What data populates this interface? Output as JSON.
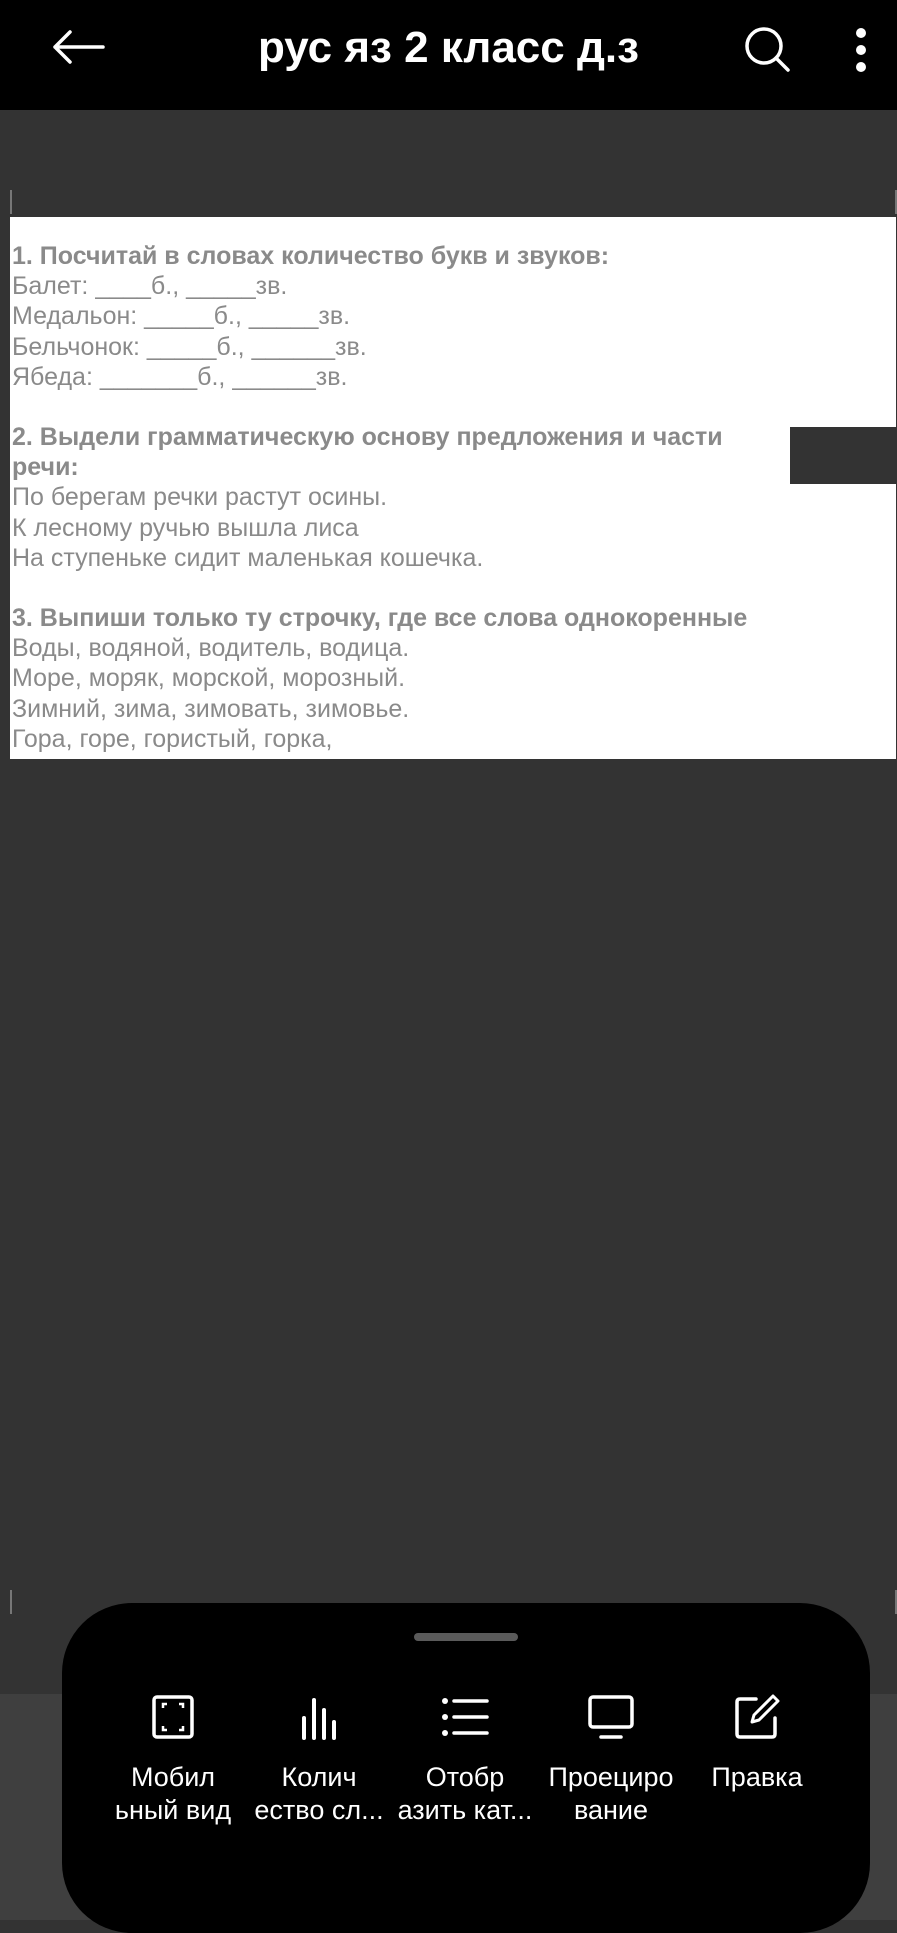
{
  "header": {
    "title": "рус яз 2 класс д.з",
    "back_icon": "arrow-left-icon",
    "search_icon": "search-icon",
    "more_icon": "more-vertical-icon"
  },
  "document": {
    "lines": [
      {
        "text": "1. Посчитай в словах количество букв и звуков:",
        "bold": true
      },
      {
        "text": "Балет:  ____б., _____зв.",
        "bold": false
      },
      {
        "text": "Медальон: _____б., _____зв.",
        "bold": false
      },
      {
        "text": "Бельчонок: _____б., ______зв.",
        "bold": false
      },
      {
        "text": "Ябеда: _______б., ______зв.",
        "bold": false
      },
      {
        "text": "",
        "bold": false
      },
      {
        "text": "2. Выдели грамматическую основу предложения и части речи:",
        "bold": true
      },
      {
        "text": "По берегам речки растут осины.",
        "bold": false
      },
      {
        "text": "К лесному ручью вышла лиса",
        "bold": false
      },
      {
        "text": "На ступеньке сидит маленькая кошечка.",
        "bold": false
      },
      {
        "text": "",
        "bold": false
      },
      {
        "text": "3. Выпиши только ту строчку, где все слова  однокоренные",
        "bold": true
      },
      {
        "text": "Воды, водяной, водитель,  водица.",
        "bold": false
      },
      {
        "text": "Море, моряк, морской, морозный.",
        "bold": false
      },
      {
        "text": "Зимний, зима, зимовать, зимовье.",
        "bold": false
      },
      {
        "text": "Гора, горе, гористый, горка,",
        "bold": false
      }
    ]
  },
  "bottom_sheet": {
    "actions": [
      {
        "label_line1": "Мобил",
        "label_line2": "ьный вид",
        "icon": "fullscreen-frame-icon"
      },
      {
        "label_line1": "Колич",
        "label_line2": "ество сл...",
        "icon": "bar-chart-icon"
      },
      {
        "label_line1": "Отобр",
        "label_line2": "азить кат...",
        "icon": "list-icon"
      },
      {
        "label_line1": "Проециро",
        "label_line2": "вание",
        "icon": "monitor-icon"
      },
      {
        "label_line1": "Правка",
        "label_line2": "",
        "icon": "edit-icon"
      }
    ]
  },
  "colors": {
    "background": "#333333",
    "topbar": "#000000",
    "sheet": "#000000",
    "doc_text": "#8a8a8a"
  }
}
